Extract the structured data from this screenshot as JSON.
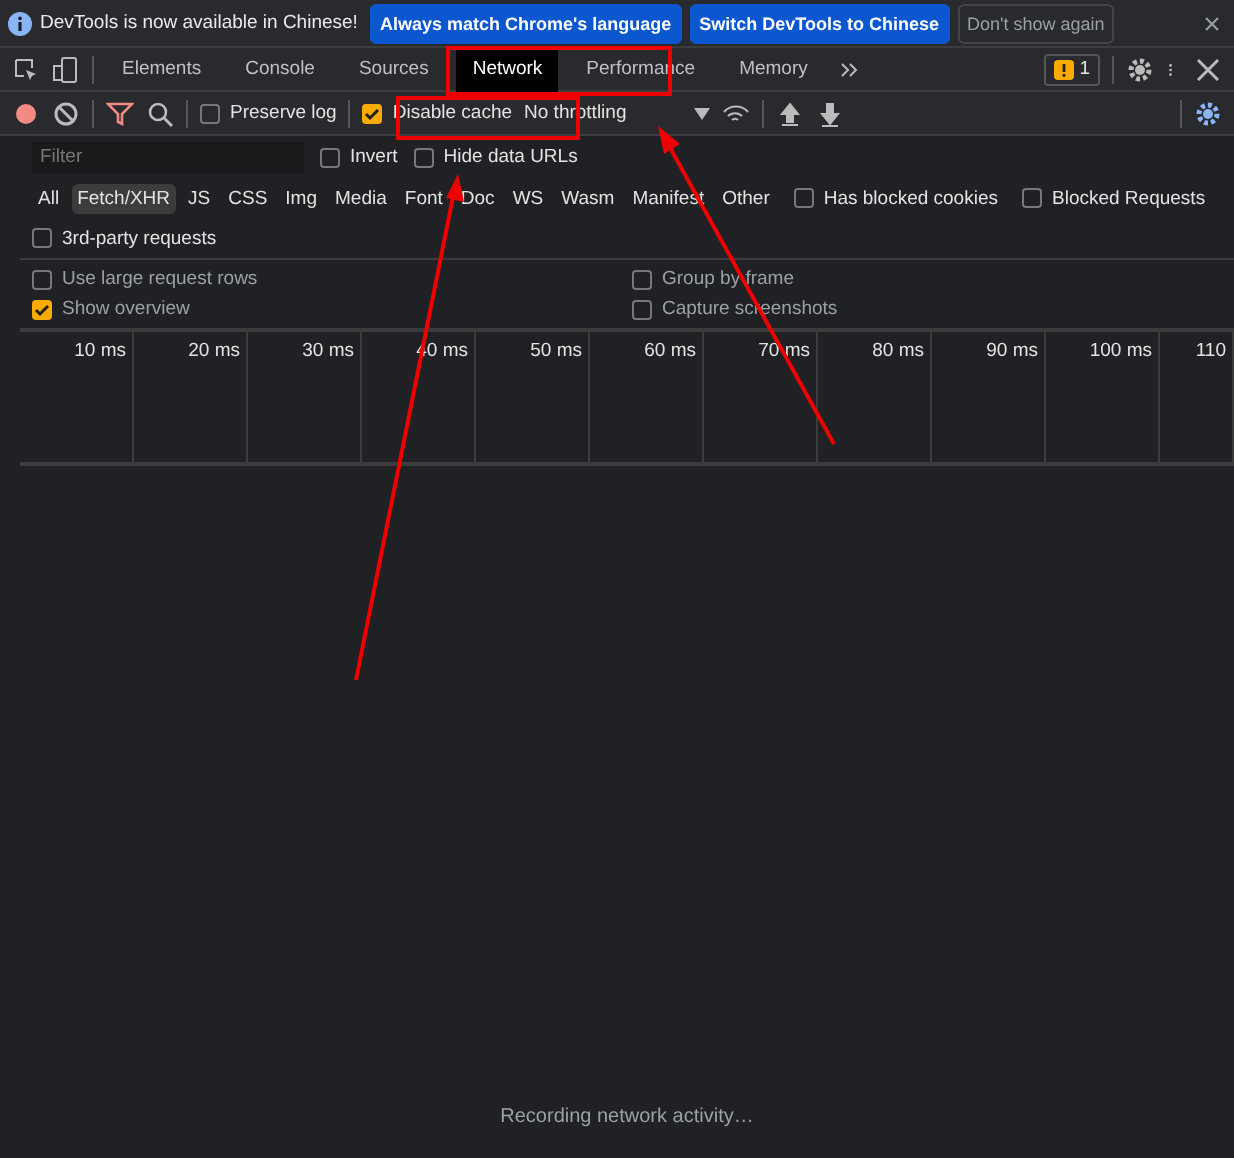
{
  "infobar": {
    "message": "DevTools is now available in Chinese!",
    "buttons": [
      {
        "label": "Always match Chrome's language",
        "kind": "primary"
      },
      {
        "label": "Switch DevTools to Chinese",
        "kind": "primary"
      },
      {
        "label": "Don't show again",
        "kind": "plain"
      }
    ]
  },
  "tabs": [
    {
      "label": "Elements",
      "selected": false
    },
    {
      "label": "Console",
      "selected": false
    },
    {
      "label": "Sources",
      "selected": false
    },
    {
      "label": "Network",
      "selected": true
    },
    {
      "label": "Performance",
      "selected": false
    },
    {
      "label": "Memory",
      "selected": false
    }
  ],
  "issues_count": "1",
  "toolbar": {
    "preserve_log": {
      "label": "Preserve log",
      "checked": false
    },
    "disable_cache": {
      "label": "Disable cache",
      "checked": true
    },
    "throttling": "No throttling"
  },
  "filter": {
    "placeholder": "Filter",
    "invert": {
      "label": "Invert",
      "checked": false
    },
    "hide_data_urls": {
      "label": "Hide data URLs",
      "checked": false
    }
  },
  "types": [
    {
      "label": "All",
      "selected": false
    },
    {
      "label": "Fetch/XHR",
      "selected": true
    },
    {
      "label": "JS",
      "selected": false
    },
    {
      "label": "CSS",
      "selected": false
    },
    {
      "label": "Img",
      "selected": false
    },
    {
      "label": "Media",
      "selected": false
    },
    {
      "label": "Font",
      "selected": false
    },
    {
      "label": "Doc",
      "selected": false
    },
    {
      "label": "WS",
      "selected": false
    },
    {
      "label": "Wasm",
      "selected": false
    },
    {
      "label": "Manifest",
      "selected": false
    },
    {
      "label": "Other",
      "selected": false
    }
  ],
  "has_blocked_cookies": {
    "label": "Has blocked cookies",
    "checked": false
  },
  "blocked_requests": {
    "label": "Blocked Requests",
    "checked": false
  },
  "third_party": {
    "label": "3rd-party requests",
    "checked": false
  },
  "settings": [
    {
      "label": "Use large request rows",
      "checked": false
    },
    {
      "label": "Group by frame",
      "checked": false
    },
    {
      "label": "Show overview",
      "checked": true
    },
    {
      "label": "Capture screenshots",
      "checked": false
    }
  ],
  "timeline": {
    "ticks": [
      "10 ms",
      "20 ms",
      "30 ms",
      "40 ms",
      "50 ms",
      "60 ms",
      "70 ms",
      "80 ms",
      "90 ms",
      "100 ms",
      "110"
    ]
  },
  "status": "Recording network activity…"
}
